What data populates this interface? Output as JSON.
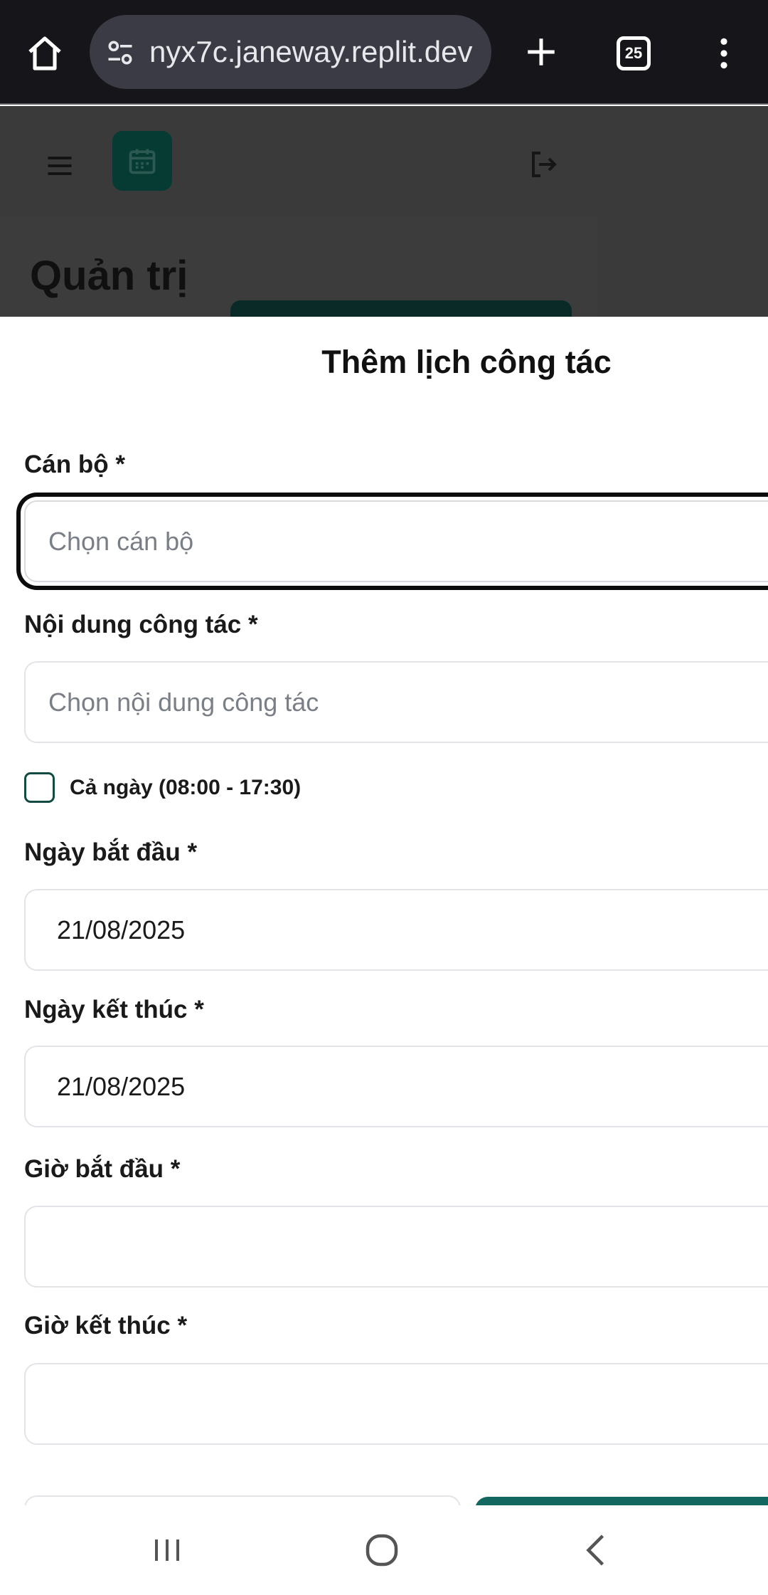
{
  "browser": {
    "url": "nyx7c.janeway.replit.dev",
    "tab_count": "25",
    "colors": {
      "bar_bg": "#15151a",
      "pill_bg": "#3a3b44"
    },
    "icons": [
      "home-icon",
      "site-settings-icon",
      "plus-icon",
      "tab-switcher-icon",
      "more-vert-icon"
    ]
  },
  "app": {
    "page_title": "Quản trị",
    "icons": [
      "hamburger-menu-icon",
      "calendar-icon",
      "logout-icon"
    ],
    "colors": {
      "brand": "#063b33",
      "primary_button": "#126860"
    }
  },
  "modal": {
    "title": "Thêm lịch công tác",
    "fields": {
      "staff": {
        "label": "Cán bộ *",
        "placeholder": "Chọn cán bộ"
      },
      "content": {
        "label": "Nội dung công tác *",
        "placeholder": "Chọn nội dung công tác"
      },
      "all_day": {
        "label": "Cả ngày (08:00 - 17:30)",
        "checked": false
      },
      "start_date": {
        "label": "Ngày bắt đầu *",
        "value": "21/08/2025"
      },
      "end_date": {
        "label": "Ngày kết thúc *",
        "value": "21/08/2025"
      },
      "start_time": {
        "label": "Giờ bắt đầu *",
        "value": ""
      },
      "end_time": {
        "label": "Giờ kết thúc *",
        "value": ""
      }
    }
  },
  "system_nav": {
    "icons": [
      "recent-apps-icon",
      "home-circle-icon",
      "back-chevron-icon"
    ]
  }
}
